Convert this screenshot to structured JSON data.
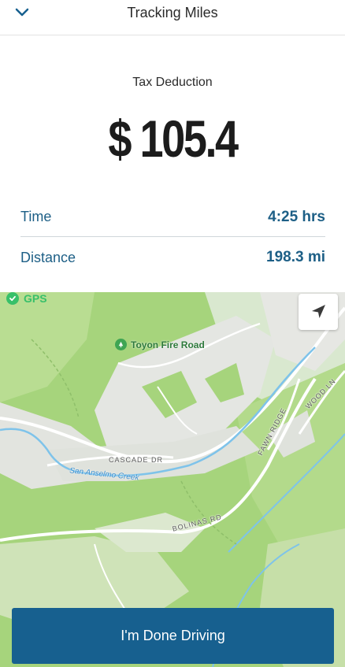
{
  "header": {
    "title": "Tracking Miles",
    "back_icon": "chevron-down-icon"
  },
  "deduction": {
    "label": "Tax Deduction",
    "amount": "$ 105.4"
  },
  "stats": {
    "time_label": "Time",
    "time_value": "4:25 hrs",
    "distance_label": "Distance",
    "distance_value": "198.3 mi"
  },
  "map": {
    "gps_label": "GPS",
    "poi_label": "Toyon Fire Road",
    "roads": [
      "CASCADE DR",
      "BOLINAS RD",
      "FAWN RIDGE",
      "WOOD LN"
    ],
    "creek": "San Anselmo Creek",
    "locate_icon": "navigation-arrow-icon"
  },
  "actions": {
    "done_label": "I'm Done Driving"
  },
  "colors": {
    "accent": "#17608f",
    "stat_text": "#1d5f86",
    "gps_green": "#38c06a",
    "map_green": "#a9d67f"
  }
}
